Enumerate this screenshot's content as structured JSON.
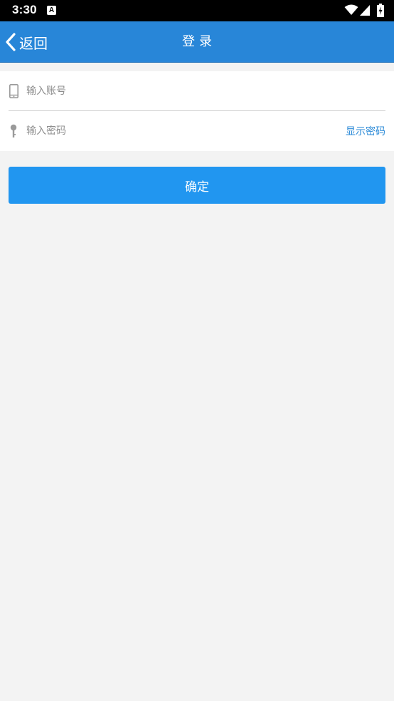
{
  "status_bar": {
    "time": "3:30",
    "notification_icon_letter": "A",
    "icons": [
      "wifi-icon",
      "signal-icon",
      "battery-icon"
    ]
  },
  "header": {
    "back_label": "返回",
    "title": "登录",
    "background_color": "#2886d8"
  },
  "form": {
    "account": {
      "placeholder": "输入账号",
      "icon": "phone-icon"
    },
    "password": {
      "placeholder": "输入密码",
      "icon": "key-icon",
      "show_password_label": "显示密码"
    }
  },
  "actions": {
    "confirm_label": "确定",
    "confirm_color": "#2196f0"
  }
}
